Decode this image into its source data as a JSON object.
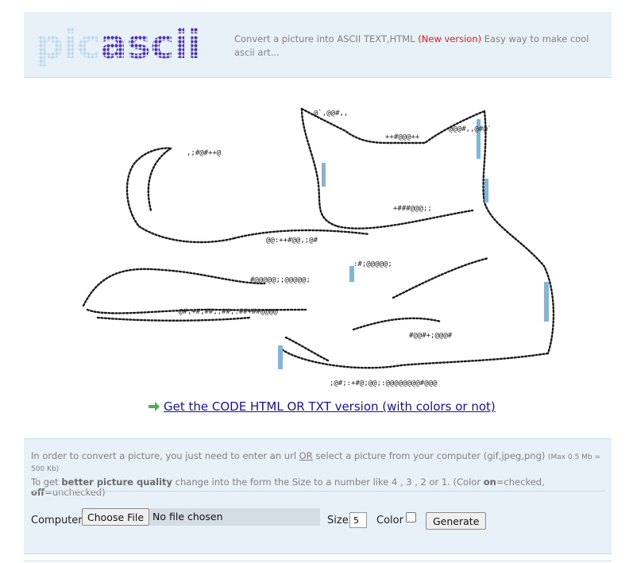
{
  "header": {
    "logo": {
      "part1": "pic",
      "part2": "ascii"
    },
    "tagline": {
      "text": "Convert a picture into ASCII TEXT,HTML",
      "new_version": "(New version)",
      "rest": "Easy way to make cool ascii art..."
    }
  },
  "code_link": {
    "icon": "green-right-arrow-icon",
    "label": " Get the CODE HTML OR TXT version (with colors or not)"
  },
  "form": {
    "instructions": {
      "l1_a": "In order to convert a picture, you just need to enter an url ",
      "l1_or": "OR",
      "l1_b": " select a picture from your computer (gif,jpeg,png) ",
      "l1_small": "(Max 0.5 Mb = 500 Kb)",
      "l2_a": "To get ",
      "l2_bold": "better picture quality",
      "l2_b": " change into the form the Size to a number like 4 , 3 , 2 or 1. (Color ",
      "l2_on": "on",
      "l2_c": "=checked, ",
      "l2_off": "off",
      "l2_d": "=unchecked)"
    },
    "computer_label": "Computer",
    "file_button": "Choose File",
    "file_status": "No file chosen",
    "size_label": "Size",
    "size_value": "5",
    "color_label": "Color",
    "color_checked": false,
    "generate_button": "Generate"
  },
  "colors": {
    "logo_pic": "#bdd9ee",
    "logo_ascii": "#4c33b8",
    "link": "#1a0dab",
    "arrow": "#4caf50",
    "new_version": "#e02020",
    "art_dark": "#1a1a1a",
    "art_highlight": "#7fb6d9"
  }
}
